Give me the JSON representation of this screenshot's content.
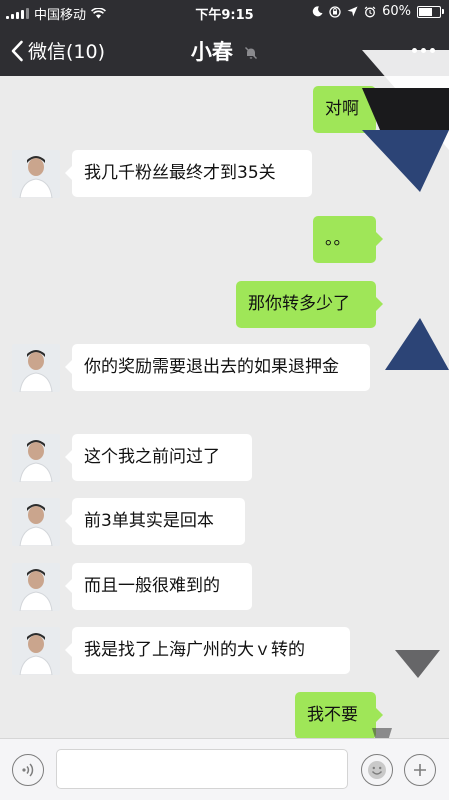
{
  "status_bar": {
    "carrier": "中国移动",
    "time": "下午9:15",
    "battery": "60%"
  },
  "nav": {
    "back_label": "微信(10)",
    "title": "小春"
  },
  "messages": [
    {
      "side": "right",
      "text": "对啊"
    },
    {
      "side": "left",
      "text": "我几千粉丝最终才到35关"
    },
    {
      "side": "right",
      "text": "。。"
    },
    {
      "side": "right",
      "text": "那你转多少了"
    },
    {
      "side": "left",
      "text": "你的奖励需要退出去的如果退押金"
    },
    {
      "side": "left",
      "text": "这个我之前问过了"
    },
    {
      "side": "left",
      "text": "前3单其实是回本"
    },
    {
      "side": "left",
      "text": "而且一般很难到的"
    },
    {
      "side": "left",
      "text": "我是找了上海广州的大ｖ转的"
    },
    {
      "side": "right",
      "text": "我不要"
    }
  ],
  "colors": {
    "header_bg": "#2e2e32",
    "chat_bg": "#ebebeb",
    "sent_bubble": "#9fe658",
    "received_bubble": "#ffffff"
  },
  "icons": {
    "back": "chevron-left-icon",
    "mute": "bell-mute-icon",
    "more": "more-dots-icon",
    "voice": "voice-icon",
    "emoji": "emoji-icon",
    "plus": "plus-icon"
  }
}
